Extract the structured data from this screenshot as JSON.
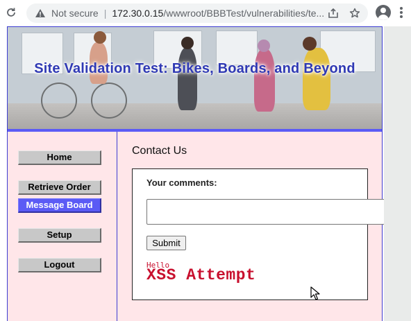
{
  "browser": {
    "security_label": "Not secure",
    "url_host": "172.30.0.15",
    "url_path": "/wwwroot/BBBTest/vulnerabilities/te..."
  },
  "site": {
    "title": "Site Validation Test: Bikes, Boards, and Beyond",
    "accent_color": "#5b5bf5",
    "title_color": "#2f39b4",
    "background_color": "#ffe6e9"
  },
  "nav": {
    "items": [
      {
        "label": "Home",
        "active": false
      },
      {
        "label": "Retrieve Order",
        "active": false
      },
      {
        "label": "Message Board",
        "active": true
      },
      {
        "label": "Setup",
        "active": false
      },
      {
        "label": "Logout",
        "active": false
      }
    ]
  },
  "main": {
    "heading": "Contact Us",
    "form": {
      "comments_label": "Your comments:",
      "comments_value": "",
      "submit_label": "Submit"
    },
    "posted_message": {
      "small_text": "Hello",
      "large_text": "XSS Attempt",
      "color": "#c8102e"
    }
  },
  "icons": [
    "reload-icon",
    "warning-icon",
    "share-icon",
    "star-icon",
    "profile-icon",
    "menu-icon",
    "cursor-icon"
  ]
}
